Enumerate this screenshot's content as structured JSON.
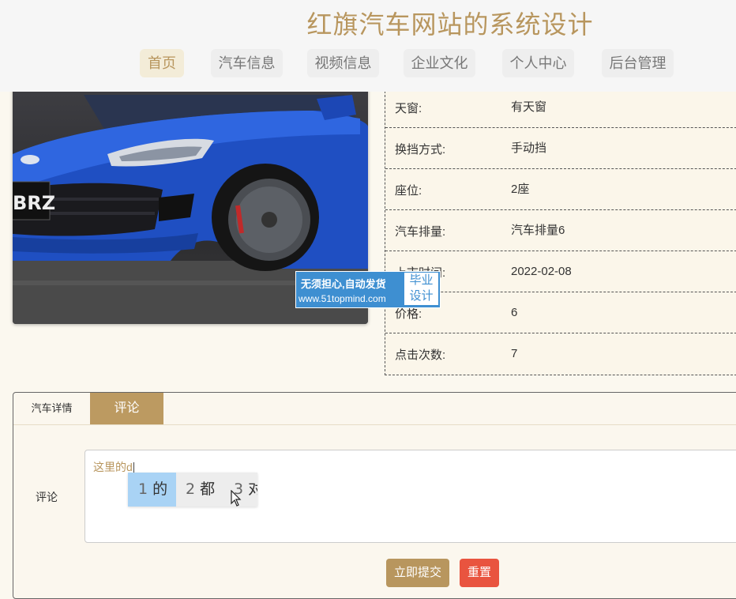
{
  "site": {
    "title": "红旗汽车网站的系统设计"
  },
  "nav": [
    {
      "label": "首页",
      "active": true
    },
    {
      "label": "汽车信息"
    },
    {
      "label": "视频信息"
    },
    {
      "label": "企业文化"
    },
    {
      "label": "个人中心"
    },
    {
      "label": "后台管理"
    }
  ],
  "car_image": {
    "plate_text": "BRZ"
  },
  "watermark": {
    "line1": "无须担心,自动发货",
    "line2": "www.51topmind.com",
    "badge_top": "毕业",
    "badge_bottom": "设计"
  },
  "details": [
    {
      "label": "天窗:",
      "value": "有天窗"
    },
    {
      "label": "换挡方式:",
      "value": "手动挡"
    },
    {
      "label": "座位:",
      "value": "2座"
    },
    {
      "label": "汽车排量:",
      "value": "汽车排量6"
    },
    {
      "label": "上市时间:",
      "value": "2022-02-08"
    },
    {
      "label": "价格:",
      "value": "6"
    },
    {
      "label": "点击次数:",
      "value": "7"
    }
  ],
  "tabs": [
    {
      "label": "汽车详情"
    },
    {
      "label": "评论",
      "active": true
    }
  ],
  "comment_form": {
    "label": "评论",
    "value": "这里的d",
    "submit_label": "立即提交",
    "reset_label": "重置"
  },
  "ime": {
    "candidates": [
      {
        "num": "1",
        "text": "的"
      },
      {
        "num": "2",
        "text": "都"
      },
      {
        "num": "3",
        "text": "对"
      }
    ]
  }
}
